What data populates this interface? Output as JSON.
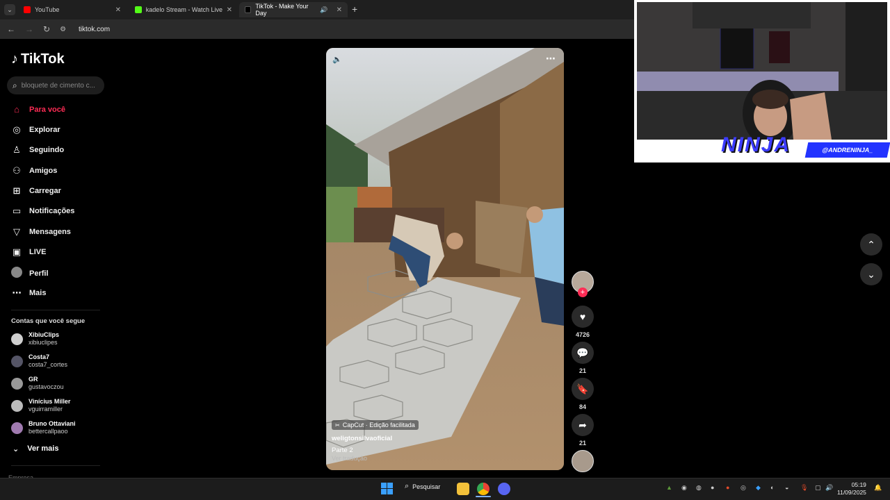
{
  "browser": {
    "tabs": [
      {
        "title": "YouTube",
        "color": "#ff0000"
      },
      {
        "title": "kadelo Stream - Watch Live on",
        "color": "#53fc18"
      },
      {
        "title": "TikTok - Make Your Day",
        "color": "#000000"
      }
    ],
    "url": "tiktok.com"
  },
  "sidebar": {
    "logo": "TikTok",
    "search_placeholder": "bloquete de cimento c...",
    "nav": [
      {
        "label": "Para você",
        "icon": "home-icon"
      },
      {
        "label": "Explorar",
        "icon": "compass-icon"
      },
      {
        "label": "Seguindo",
        "icon": "following-icon"
      },
      {
        "label": "Amigos",
        "icon": "friends-icon"
      },
      {
        "label": "Carregar",
        "icon": "upload-icon"
      },
      {
        "label": "Notificações",
        "icon": "notification-icon"
      },
      {
        "label": "Mensagens",
        "icon": "message-icon"
      },
      {
        "label": "LIVE",
        "icon": "live-icon"
      },
      {
        "label": "Perfil",
        "icon": "profile-icon"
      },
      {
        "label": "Mais",
        "icon": "more-icon"
      }
    ],
    "following_title": "Contas que você segue",
    "accounts": [
      {
        "name": "XibiuClips",
        "handle": "xibiuclipes"
      },
      {
        "name": "Costa7",
        "handle": "costa7_cortes"
      },
      {
        "name": "GR",
        "handle": "gustavoczou"
      },
      {
        "name": "Vinícius Miller",
        "handle": "vguirramiller"
      },
      {
        "name": "Bruno Ottaviani",
        "handle": "bettercallpaoo"
      }
    ],
    "see_more": "Ver mais",
    "footer": "Empresa"
  },
  "video": {
    "capcut": "CapCut · Edição facilitada",
    "author": "weligtonsilvaoficial",
    "description": "Parte 2",
    "translate": "Ver tradução"
  },
  "actions": {
    "likes": "4726",
    "comments": "21",
    "saves": "84",
    "shares": "21"
  },
  "stream": {
    "name": "NINJA",
    "handle": "@ANDRENINJA_"
  },
  "taskbar": {
    "search": "Pesquisar",
    "time": "05:19",
    "date": "11/09/2025"
  }
}
